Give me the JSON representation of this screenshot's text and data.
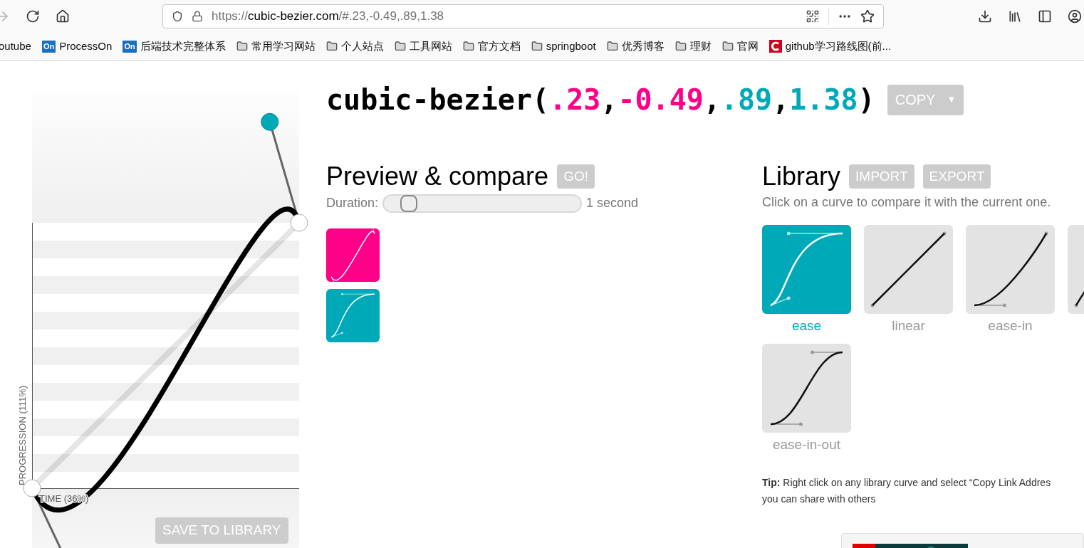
{
  "browser": {
    "nav": [
      {
        "kind": "back",
        "disabled": true
      },
      {
        "kind": "reload",
        "disabled": false
      },
      {
        "kind": "home",
        "disabled": false
      }
    ],
    "url": {
      "scheme": "https://",
      "host": "cubic-bezier.com",
      "path": "/#.23,-0.49,.89,1.38"
    },
    "bookmarks": [
      {
        "kind": "plain",
        "label": "outube"
      },
      {
        "kind": "badge",
        "badge": "On",
        "label": "ProcessOn"
      },
      {
        "kind": "badge",
        "badge": "On",
        "label": "后端技术完整体系"
      },
      {
        "kind": "folder",
        "label": "常用学习网站"
      },
      {
        "kind": "folder",
        "label": "个人站点"
      },
      {
        "kind": "folder",
        "label": "工具网站"
      },
      {
        "kind": "folder",
        "label": "官方文档"
      },
      {
        "kind": "folder",
        "label": "springboot"
      },
      {
        "kind": "folder",
        "label": "优秀博客"
      },
      {
        "kind": "folder",
        "label": "理财"
      },
      {
        "kind": "folder",
        "label": "官网"
      },
      {
        "kind": "logo",
        "label": "github学习路线图(前..."
      }
    ]
  },
  "graph": {
    "progression_label": "PROGRESSION (111%)",
    "time_label": "TIME (36%)",
    "save_button": "SAVE TO LIBRARY"
  },
  "title": {
    "parts": [
      {
        "kind": "punct",
        "text": "cubic-bezier(",
        "color": "#000000"
      },
      {
        "kind": "value",
        "text": ".23",
        "color": "#ff0088"
      },
      {
        "kind": "punct",
        "text": ",",
        "color": "#000000"
      },
      {
        "kind": "value",
        "text": "-0.49",
        "color": "#ff0088"
      },
      {
        "kind": "punct",
        "text": ",",
        "color": "#000000"
      },
      {
        "kind": "value",
        "text": ".89",
        "color": "#00a9b8"
      },
      {
        "kind": "punct",
        "text": ",",
        "color": "#000000"
      },
      {
        "kind": "value",
        "text": "1.38",
        "color": "#00a9b8"
      },
      {
        "kind": "punct",
        "text": ")",
        "color": "#000000"
      }
    ],
    "copy_button": "COPY",
    "copy_caret": "▼"
  },
  "preview": {
    "heading": "Preview & compare",
    "go_button": "GO!",
    "duration_label": "Duration:",
    "level": 0.1,
    "duration_value": "1 second"
  },
  "library": {
    "heading": "Library",
    "buttons": [
      "IMPORT",
      "EXPORT"
    ],
    "hint": "Click on a curve to compare it with the current one.",
    "items": [
      {
        "kind": "ease",
        "label": "ease",
        "selected": true
      },
      {
        "kind": "linear",
        "label": "linear",
        "selected": false
      },
      {
        "kind": "ease-in",
        "label": "ease-in",
        "selected": false
      },
      {
        "kind": "ease-out",
        "selected": false
      },
      {
        "kind": "ease-in-out",
        "label": "ease-in-out",
        "selected": false
      }
    ],
    "tip": "**Tip:** Right click on any library curve and select “Copy Link Addres",
    "tip_line2": "you can share with others"
  }
}
